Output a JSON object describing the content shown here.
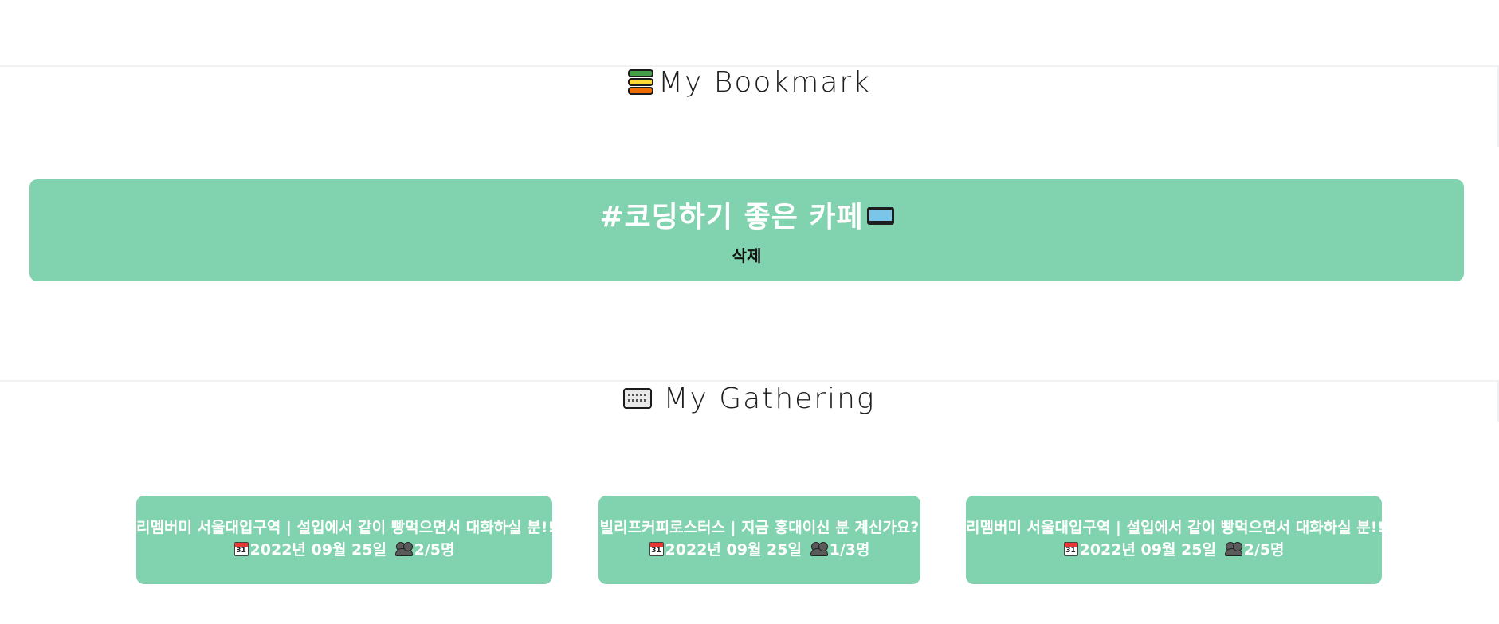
{
  "bookmark_section": {
    "title": "My Bookmark",
    "icon": "books-icon",
    "card": {
      "tag": "#코딩하기 좋은 카페",
      "tag_icon": "laptop-icon",
      "delete_label": "삭제"
    }
  },
  "gathering_section": {
    "title": "My Gathering",
    "icon": "keyboard-icon",
    "cards": [
      {
        "title": "리멤버미 서울대입구역 | 설입에서 같이 빵먹으면서 대화하실 분!!",
        "date": "2022년 09월 25일",
        "members": "2/5명"
      },
      {
        "title": "빌리프커피로스터스 | 지금 홍대이신 분 계신가요?",
        "date": "2022년 09월 25일",
        "members": "1/3명"
      },
      {
        "title": "리멤버미 서울대입구역 | 설입에서 같이 빵먹으면서 대화하실 분!!",
        "date": "2022년 09월 25일",
        "members": "2/5명"
      }
    ]
  },
  "colors": {
    "card_bg": "#81d2ae",
    "card_text": "#ffffff",
    "title_text": "#1e1e1e"
  }
}
